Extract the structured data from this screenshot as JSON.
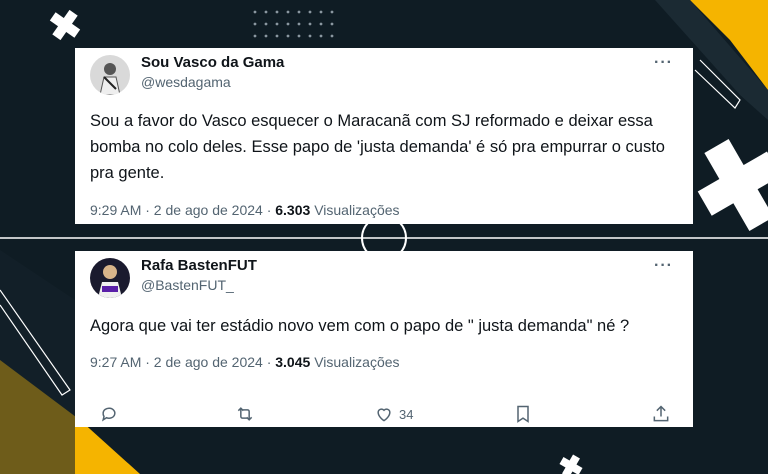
{
  "tweets": [
    {
      "name": "Sou Vasco da Gama",
      "handle": "@wesdagama",
      "text": "Sou a favor do Vasco esquecer o Maracanã com SJ reformado e deixar essa bomba no colo deles. Esse papo de 'justa demanda' é só pra empurrar o custo pra gente.",
      "time": "9:29 AM · 2 de ago de 2024 ·",
      "views_count": "6.303",
      "views_label": "Visualizações"
    },
    {
      "name": "Rafa BastenFUT",
      "handle": "@BastenFUT_",
      "text": "Agora que vai ter estádio novo vem com o papo de \" justa demanda\" né ?",
      "time": "9:27 AM · 2 de ago de 2024 ·",
      "views_count": "3.045",
      "views_label": "Visualizações",
      "likes": "34"
    }
  ],
  "icons": {
    "more": "more-horizontal-icon",
    "reply": "reply-icon",
    "retweet": "retweet-icon",
    "like": "heart-icon",
    "bookmark": "bookmark-icon",
    "share": "share-icon"
  },
  "colors": {
    "background": "#0f1c24",
    "accent_yellow": "#f5b400",
    "card": "#ffffff",
    "secondary_text": "#536471"
  },
  "more_glyph": "···"
}
